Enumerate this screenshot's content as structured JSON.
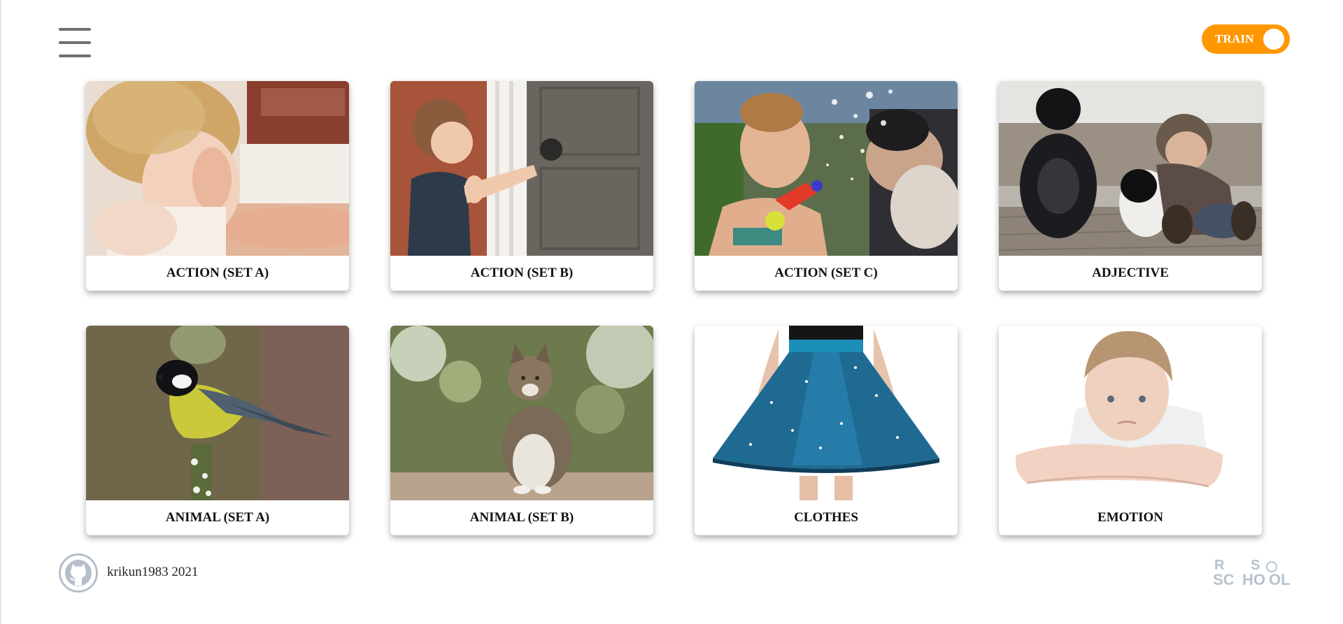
{
  "header": {
    "menu_icon": "hamburger-icon",
    "mode_toggle": {
      "label": "TRAIN",
      "color": "#ff9800"
    }
  },
  "categories": [
    {
      "title": "ACTION (SET A)",
      "image": "child-covering-face"
    },
    {
      "title": "ACTION (SET B)",
      "image": "boy-opening-door"
    },
    {
      "title": "ACTION (SET C)",
      "image": "woman-water-gun-splash"
    },
    {
      "title": "ADJECTIVE",
      "image": "boy-with-two-dogs"
    },
    {
      "title": "ANIMAL (SET A)",
      "image": "great-tit-bird"
    },
    {
      "title": "ANIMAL (SET B)",
      "image": "tabby-cat-sitting"
    },
    {
      "title": "CLOTHES",
      "image": "blue-skirt"
    },
    {
      "title": "EMOTION",
      "image": "sad-boy"
    }
  ],
  "footer": {
    "github_icon": "github-icon",
    "author": "krikun1983 2021",
    "logo_text": "RS SCHOOL"
  }
}
